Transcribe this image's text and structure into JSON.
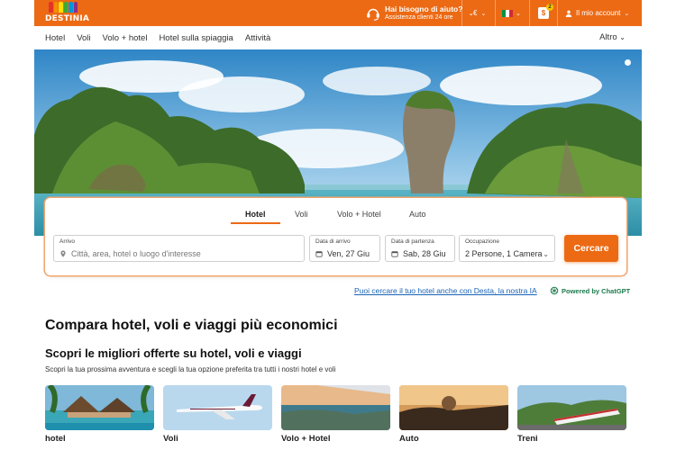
{
  "brand": {
    "logo_text": "DESTINIA",
    "accent_color": "#ec6a14",
    "logo_colors": [
      "#e6332a",
      "#f29100",
      "#ffde00",
      "#3aaa35",
      "#0097d7",
      "#8a2e8f"
    ]
  },
  "topbar": {
    "help_line1": "Hai bisogno di aiuto?",
    "help_line2": "Assistenza clienti 24 ore",
    "currency": "€",
    "language_flag": "italy-flag",
    "badge_count": "2",
    "account_label": "Il mio account"
  },
  "nav": {
    "items": [
      "Hotel",
      "Voli",
      "Volo + hotel",
      "Hotel sulla spiaggia",
      "Attività"
    ],
    "more_label": "Altro"
  },
  "search": {
    "tabs": [
      "Hotel",
      "Voli",
      "Volo + Hotel",
      "Auto"
    ],
    "active_tab": "Hotel",
    "destination_label": "Arrivo",
    "destination_placeholder": "Città, area, hotel o luogo d'interesse",
    "checkin_label": "Data di arrivo",
    "checkin_value": "Ven, 27 Giu",
    "checkout_label": "Data di partenza",
    "checkout_value": "Sab, 28 Giu",
    "occupancy_label": "Occupazione",
    "occupancy_value": "2 Persone, 1 Camera",
    "search_button": "Cercare"
  },
  "desta": {
    "link_text": "Puoi cercare il tuo hotel anche con Desta, la nostra IA",
    "powered_text": "Powered by ChatGPT"
  },
  "main": {
    "title": "Compara hotel, voli e viaggi più economici",
    "subtitle": "Scopri le migliori offerte su hotel, voli e viaggi",
    "description": "Scopri la tua prossima avventura e scegli la tua opzione preferita tra tutti i nostri hotel e voli",
    "cards": [
      {
        "label": "hotel"
      },
      {
        "label": "Voli"
      },
      {
        "label": "Volo + Hotel"
      },
      {
        "label": "Auto"
      },
      {
        "label": "Treni"
      }
    ]
  }
}
